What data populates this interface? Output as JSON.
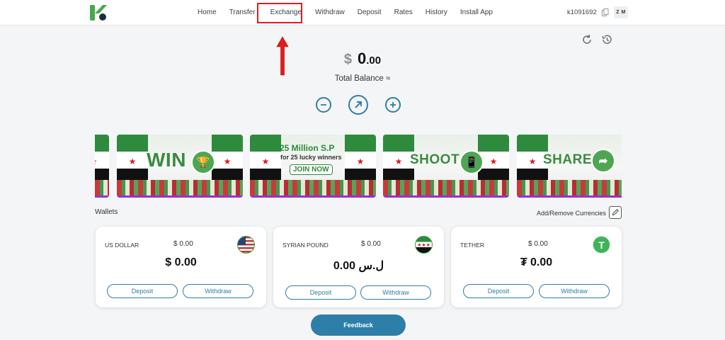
{
  "nav": {
    "items": [
      {
        "label": "Home"
      },
      {
        "label": "Transfer"
      },
      {
        "label": "Exchange"
      },
      {
        "label": "Withdraw"
      },
      {
        "label": "Deposit"
      },
      {
        "label": "Rates"
      },
      {
        "label": "History"
      },
      {
        "label": "Install App"
      }
    ]
  },
  "user": {
    "id": "k1091692",
    "initials": "Z M"
  },
  "balance": {
    "currency_symbol": "$",
    "integer": "0",
    "decimals": ".00",
    "label": "Total Balance ≈"
  },
  "banners": [
    {
      "text": "WIN",
      "icon": "trophy-icon"
    },
    {
      "line1": "25 Million S.P",
      "line2": "for 25 lucky winners",
      "cta": "JOIN NOW"
    },
    {
      "text": "SHOOT",
      "icon": "phone-icon"
    },
    {
      "text": "SHARE",
      "icon": "share-icon"
    }
  ],
  "wallets": {
    "title": "Wallets",
    "add_remove": "Add/Remove Currencies",
    "cards": [
      {
        "name": "US DOLLAR",
        "small_balance": "$ 0.00",
        "amount": "$  0.00",
        "deposit": "Deposit",
        "withdraw": "Withdraw",
        "icon": "us-flag-icon"
      },
      {
        "name": "SYRIAN POUND",
        "small_balance": "$ 0.00",
        "amount": "ل.س  0.00",
        "deposit": "Deposit",
        "withdraw": "Withdraw",
        "icon": "syria-flag-icon"
      },
      {
        "name": "TETHER",
        "small_balance": "$ 0.00",
        "amount": "₮  0.00",
        "deposit": "Deposit",
        "withdraw": "Withdraw",
        "icon": "tether-icon"
      }
    ]
  },
  "feedback_label": "Feedback",
  "colors": {
    "accent": "#2f7ea6",
    "highlight": "#e31b1b",
    "brand_green": "#2c8a38"
  }
}
